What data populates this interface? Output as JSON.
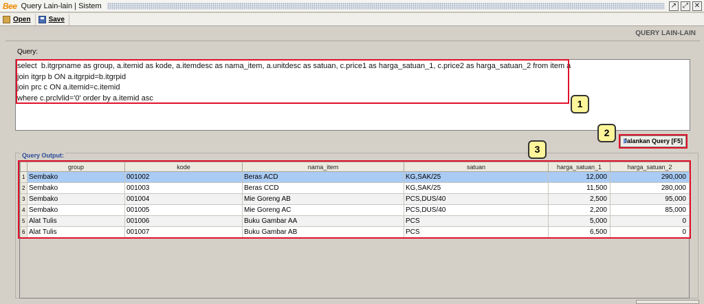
{
  "window": {
    "logo": "Bee",
    "title": "Query Lain-lain | Sistem",
    "controls": [
      "↗",
      "⤢",
      "✕"
    ]
  },
  "toolbar": {
    "open_label": "Open",
    "save_label": "Save"
  },
  "page": {
    "heading": "QUERY LAIN-LAIN"
  },
  "query": {
    "label": "Query:",
    "text": "select  b.itgrpname as group, a.itemid as kode, a.itemdesc as nama_item, a.unitdesc as satuan, c.price1 as harga_satuan_1, c.price2 as harga_satuan_2 from item a\njoin itgrp b ON a.itgrpid=b.itgrpid\njoin prc c ON a.itemid=c.itemid\nwhere c.prclvlid='0' order by a.itemid asc",
    "run_button": "Jalankan Query [F5]"
  },
  "callouts": [
    "1",
    "2",
    "3"
  ],
  "colors": {
    "highlight_border": "#e0102a",
    "callout_fill": "#fff59a",
    "selected_row": "#a9cbf4"
  },
  "output": {
    "label": "Query Output:",
    "columns": [
      "group",
      "kode",
      "nama_item",
      "satuan",
      "harga_satuan_1",
      "harga_satuan_2"
    ],
    "rows": [
      [
        "1",
        "Sembako",
        "001002",
        "Beras ACD",
        "KG,SAK/25",
        "12,000",
        "290,000"
      ],
      [
        "2",
        "Sembako",
        "001003",
        "Beras CCD",
        "KG,SAK/25",
        "11,500",
        "280,000"
      ],
      [
        "3",
        "Sembako",
        "001004",
        "Mie Goreng AB",
        "PCS,DUS/40",
        "2,500",
        "95,000"
      ],
      [
        "4",
        "Sembako",
        "001005",
        "Mie Goreng AC",
        "PCS,DUS/40",
        "2,200",
        "85,000"
      ],
      [
        "5",
        "Alat Tulis",
        "001006",
        "Buku Gambar AA",
        "PCS",
        "5,000",
        "0"
      ],
      [
        "6",
        "Alat Tulis",
        "001007",
        "Buku Gambar AB",
        "PCS",
        "6,500",
        "0"
      ]
    ]
  }
}
